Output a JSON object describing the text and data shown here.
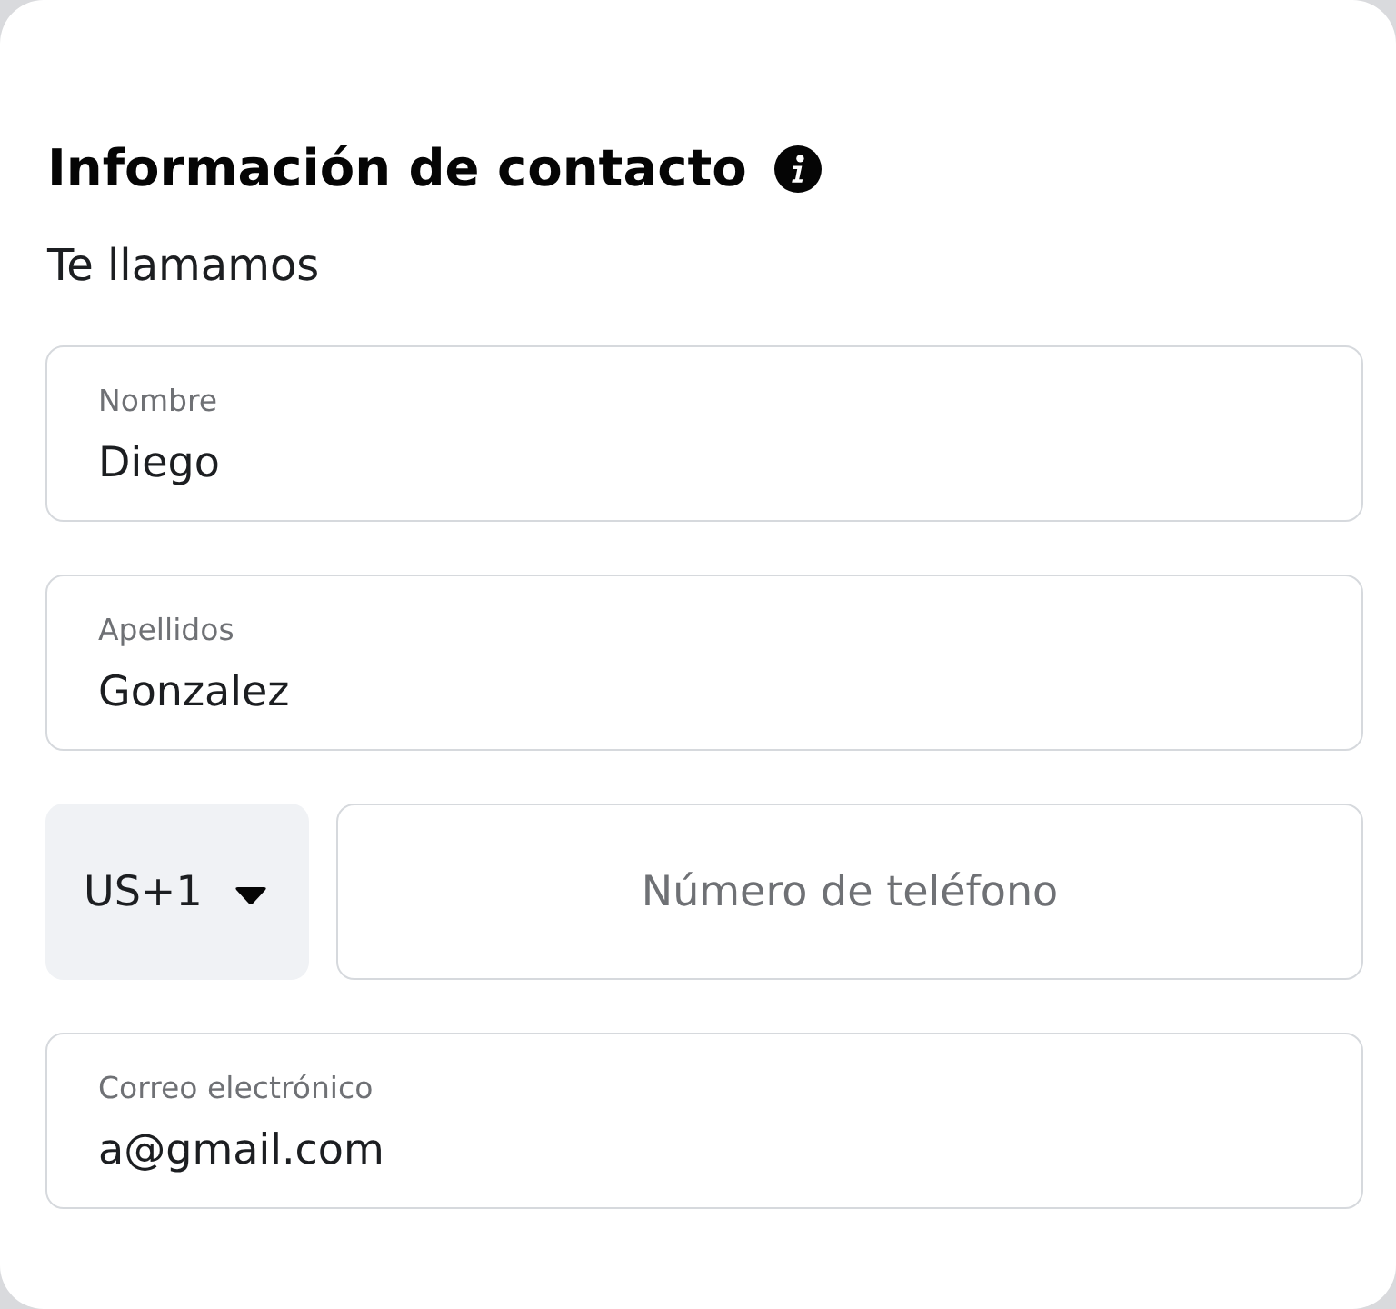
{
  "form": {
    "title": "Información de contacto",
    "subtitle": "Te llamamos"
  },
  "fields": [
    {
      "kind": "text",
      "label": "Nombre",
      "value": "Diego"
    },
    {
      "kind": "text",
      "label": "Apellidos",
      "value": "Gonzalez"
    },
    {
      "kind": "phone",
      "country_code": "US+1",
      "placeholder": "Número de teléfono"
    },
    {
      "kind": "text",
      "label": "Correo electrónico",
      "value": "a@gmail.com"
    }
  ]
}
